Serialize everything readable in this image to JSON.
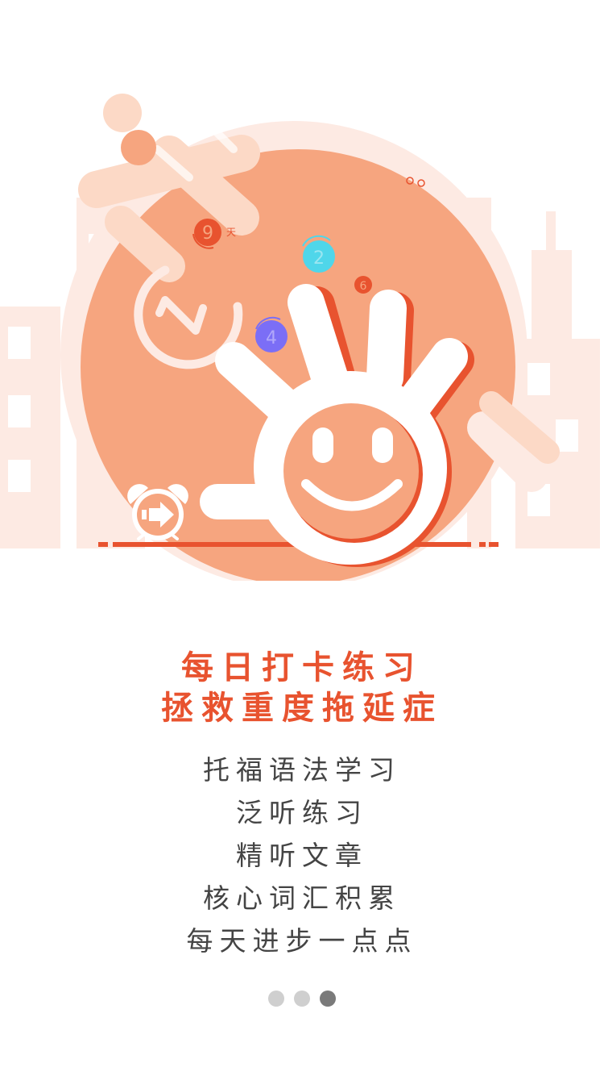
{
  "illustration": {
    "badges": [
      {
        "name": "badge-9",
        "text": "9",
        "suffix": "天"
      },
      {
        "name": "badge-2",
        "text": "2"
      },
      {
        "name": "badge-6",
        "text": "6"
      },
      {
        "name": "badge-4",
        "text": "4"
      }
    ],
    "colors": {
      "main_orange": "#f6a57f",
      "light_peach": "#fcd9c6",
      "pale_pink": "#fdeae3",
      "accent_red": "#e8532f",
      "cyan": "#4fd6ea",
      "purple": "#7b6ef6",
      "white": "#ffffff"
    },
    "icons": [
      "smiley-mascot-icon",
      "alarm-clock-icon",
      "arrow-right-icon",
      "clock-logo-icon"
    ]
  },
  "headline": {
    "line1": "每日打卡练习",
    "line2": "拯救重度拖延症"
  },
  "features": [
    "托福语法学习",
    "泛听练习",
    "精听文章",
    "核心词汇积累",
    "每天进步一点点"
  ],
  "pagination": {
    "total": 3,
    "active_index": 2
  }
}
